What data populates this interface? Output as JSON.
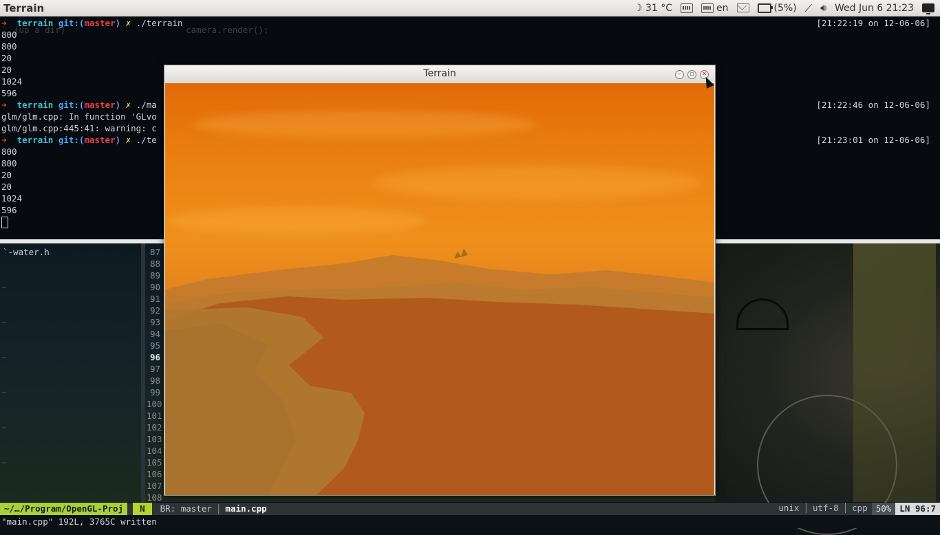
{
  "panel": {
    "app_title": "Terrain",
    "weather": "☽ 31 °C",
    "lang": "en",
    "battery": "(5%)",
    "clock": "Wed Jun  6 21:23"
  },
  "terminal": {
    "prompt_dir": "terrain",
    "git_label": "git:(",
    "branch": "master",
    "git_close": ")",
    "dirty": "✗",
    "cmd1": "./terrain",
    "cmd2": "./ma",
    "cmd3": "./te",
    "stamp1": "[21:22:19 on 12-06-06]",
    "stamp2": "[21:22:46 on 12-06-06]",
    "stamp3": "[21:23:01 on 12-06-06]",
    "out1": [
      "800",
      "800",
      "20",
      "20",
      "1024",
      "596"
    ],
    "err1": "glm/glm.cpp: In function 'GLvo",
    "err2": "glm/glm.cpp:445:41: warning: c",
    "out2": [
      "800",
      "800",
      "20",
      "20",
      "1024",
      "596"
    ]
  },
  "vim": {
    "tree_bottom": "`-water.h",
    "line_numbers": [
      "87",
      "88",
      "89",
      "90",
      "91",
      "92",
      "93",
      "94",
      "95",
      "96",
      "97",
      "98",
      "99",
      "100",
      "101",
      "102",
      "103",
      "104",
      "105",
      "106",
      "107",
      "108"
    ],
    "current_line": "96"
  },
  "statusline": {
    "path": "~/…/Program/OpenGL-Proj",
    "mode": "N",
    "branch": "BR: master",
    "file": "main.cpp",
    "format": "unix",
    "encoding": "utf-8",
    "filetype": "cpp",
    "percent": "50%",
    "ln_label": "LN",
    "position": "96:7"
  },
  "cmdline": "\"main.cpp\" 192L, 3765C written",
  "glwindow": {
    "title": "Terrain"
  }
}
